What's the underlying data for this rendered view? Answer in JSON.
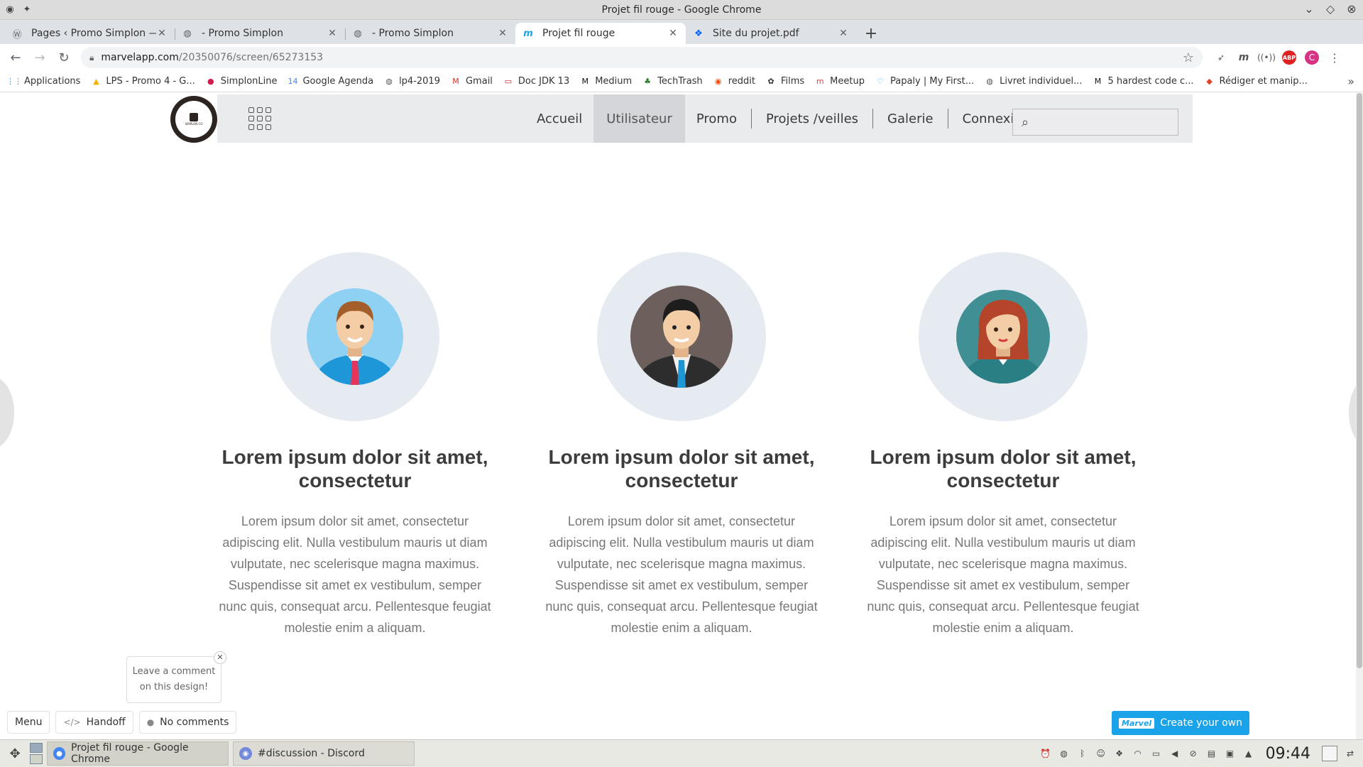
{
  "window": {
    "title": "Projet fil rouge - Google Chrome"
  },
  "tabs": [
    {
      "label": "Pages ‹ Promo Simplon — W",
      "icon": "wordpress-icon"
    },
    {
      "label": "- Promo Simplon",
      "icon": "globe-icon"
    },
    {
      "label": "- Promo Simplon",
      "icon": "globe-icon"
    },
    {
      "label": "Projet fil rouge",
      "icon": "marvel-icon",
      "active": true
    },
    {
      "label": "Site du projet.pdf",
      "icon": "dropbox-icon"
    }
  ],
  "address": {
    "host": "marvelapp.com",
    "path": "/20350076/screen/65273153"
  },
  "bookmarks": [
    {
      "label": "Applications",
      "icon": "apps-grid-icon",
      "color": "#4285f4"
    },
    {
      "label": "LPS - Promo 4 - G...",
      "icon": "google-drive-icon",
      "color": "#f4b400"
    },
    {
      "label": "SimplonLine",
      "icon": "simplon-icon",
      "color": "#d6194f"
    },
    {
      "label": "Google Agenda",
      "icon": "calendar-icon",
      "color": "#4285f4"
    },
    {
      "label": "lp4-2019",
      "icon": "globe-icon",
      "color": "#555555"
    },
    {
      "label": "Gmail",
      "icon": "gmail-icon",
      "color": "#d93025"
    },
    {
      "label": "Doc JDK 13",
      "icon": "doc-icon",
      "color": "#c5221f"
    },
    {
      "label": "Medium",
      "icon": "medium-icon",
      "color": "#111111"
    },
    {
      "label": "TechTrash",
      "icon": "techtrash-icon",
      "color": "#2e7d32"
    },
    {
      "label": "reddit",
      "icon": "reddit-icon",
      "color": "#ff4500"
    },
    {
      "label": "Films",
      "icon": "films-icon",
      "color": "#333333"
    },
    {
      "label": "Meetup",
      "icon": "meetup-icon",
      "color": "#e0393e"
    },
    {
      "label": "Papaly | My First...",
      "icon": "heart-icon",
      "color": "#29a8e0"
    },
    {
      "label": "Livret individuel...",
      "icon": "globe-icon",
      "color": "#555555"
    },
    {
      "label": "5 hardest code c...",
      "icon": "medium-icon",
      "color": "#111111"
    },
    {
      "label": "Rédiger et manip...",
      "icon": "gitlab-icon",
      "color": "#e24329"
    }
  ],
  "site": {
    "nav": [
      "Accueil",
      "Utilisateur",
      "Promo",
      "Projets /veilles",
      "Galerie",
      "Connexion"
    ],
    "active_nav": "Utilisateur",
    "search_placeholder": ""
  },
  "cards": [
    {
      "avatar": "male-blue-shirt",
      "title": "Lorem ipsum dolor sit amet, consectetur",
      "text": "Lorem ipsum dolor sit amet, consectetur adipiscing elit. Nulla vestibulum mauris ut diam vulputate, nec scelerisque magna maximus. Suspendisse sit amet ex vestibulum, semper nunc quis, consequat arcu. Pellentesque feugiat molestie enim a aliquam."
    },
    {
      "avatar": "male-suit",
      "title": "Lorem ipsum dolor sit amet, consectetur",
      "text": "Lorem ipsum dolor sit amet, consectetur adipiscing elit. Nulla vestibulum mauris ut diam vulputate, nec scelerisque magna maximus. Suspendisse sit amet ex vestibulum, semper nunc quis, consequat arcu. Pellentesque feugiat molestie enim a aliquam."
    },
    {
      "avatar": "female-red-hair",
      "title": "Lorem ipsum dolor sit amet, consectetur",
      "text": "Lorem ipsum dolor sit amet, consectetur adipiscing elit. Nulla vestibulum mauris ut diam vulputate, nec scelerisque magna maximus. Suspendisse sit amet ex vestibulum, semper nunc quis, consequat arcu. Pellentesque feugiat molestie enim a aliquam."
    }
  ],
  "marvel": {
    "comment_prompt": "Leave a comment on this design!",
    "menu": "Menu",
    "handoff": "Handoff",
    "comments": "No comments",
    "create": "Create your own",
    "brand": "Marvel"
  },
  "taskbar": {
    "tasks": [
      {
        "label": "Projet fil rouge - Google Chrome",
        "icon": "chrome-icon"
      },
      {
        "label": "#discussion - Discord",
        "icon": "discord-icon"
      }
    ],
    "clock": "09:44"
  },
  "colors": {
    "accent": "#1aa3e8",
    "nav_bg": "#eaebed",
    "avatar_bg": "#e6eaf1"
  }
}
